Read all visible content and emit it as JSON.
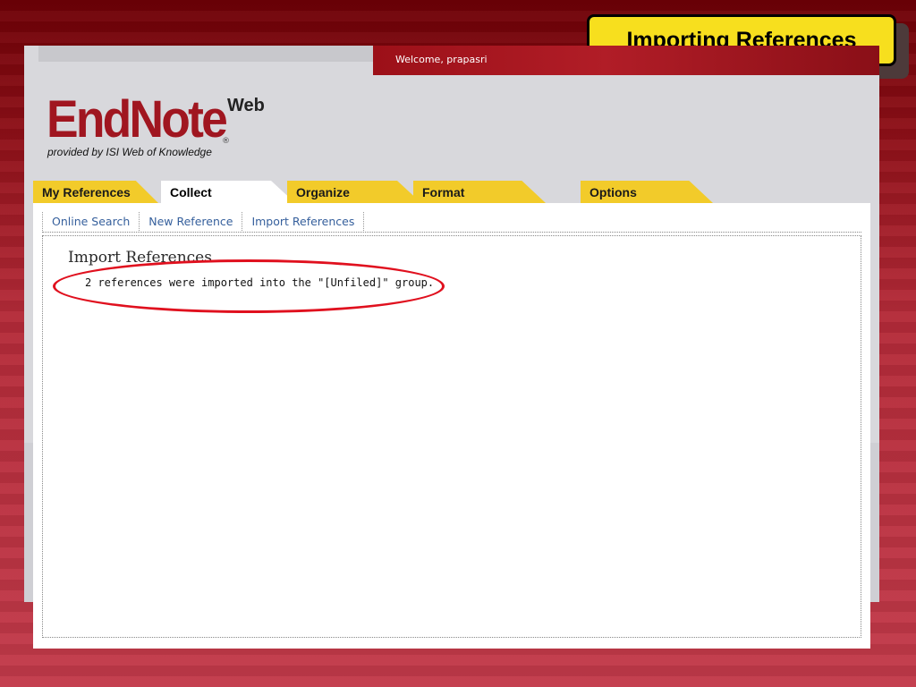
{
  "slide": {
    "title": "Importing References"
  },
  "header": {
    "welcome_text": "Welcome, prapasri",
    "logo_text": "EndNote",
    "logo_superscript": "Web",
    "logo_registered": "®",
    "logo_tagline": "provided by ISI Web of Knowledge"
  },
  "tabs": [
    {
      "label": "My References",
      "active": false
    },
    {
      "label": "Collect",
      "active": true
    },
    {
      "label": "Organize",
      "active": false
    },
    {
      "label": "Format",
      "active": false
    },
    {
      "label": "Options",
      "active": false
    }
  ],
  "subnav": [
    {
      "label": "Online Search"
    },
    {
      "label": "New Reference"
    },
    {
      "label": "Import References"
    }
  ],
  "content": {
    "heading": "Import References",
    "message": "2 references were imported into the \"[Unfiled]\" group."
  },
  "colors": {
    "brand_red": "#a01620",
    "tab_yellow": "#f2cb2a",
    "link_blue": "#355f9c",
    "highlight_red": "#e0101e",
    "callout_yellow": "#f7df1e"
  }
}
